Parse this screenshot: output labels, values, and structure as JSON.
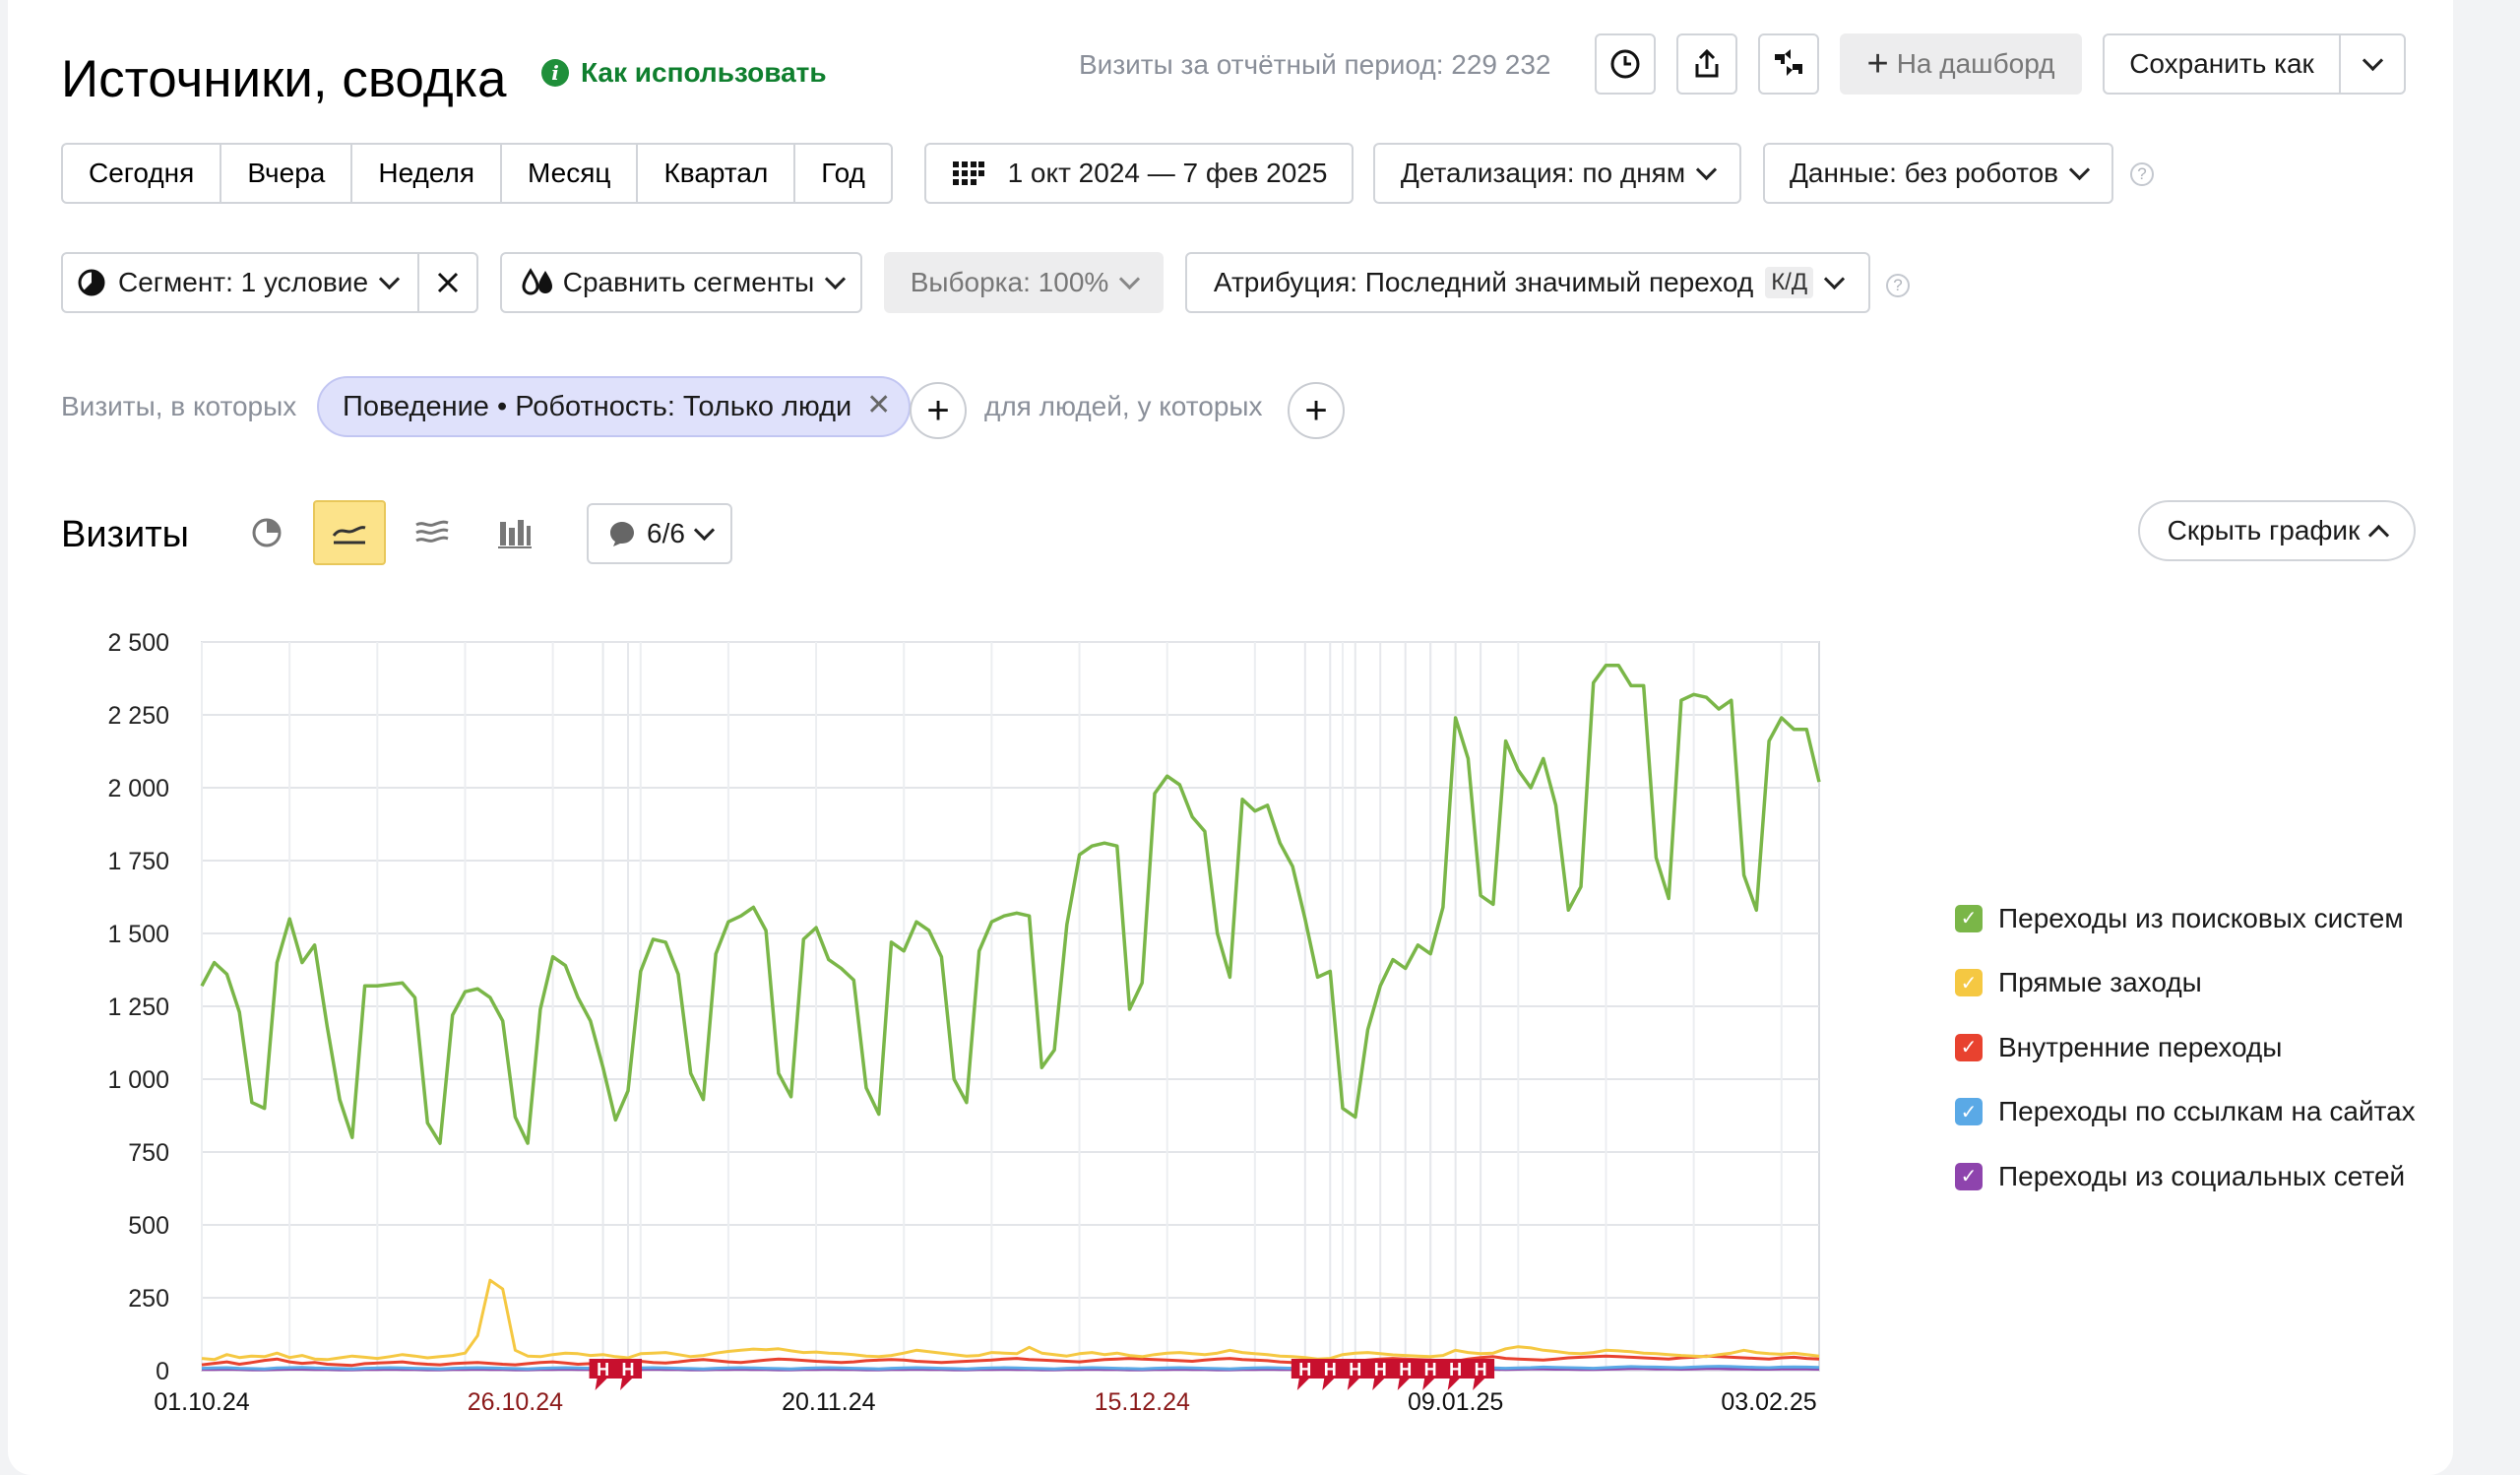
{
  "header": {
    "title": "Источники, сводка",
    "howto_label": "Как использовать",
    "visits_total": "Визиты за отчётный период: 229 232",
    "dashboard_label": "На дашборд",
    "save_as_label": "Сохранить как"
  },
  "periods": [
    "Сегодня",
    "Вчера",
    "Неделя",
    "Месяц",
    "Квартал",
    "Год"
  ],
  "date_range": "1 окт 2024 — 7 фев 2025",
  "detail_label": "Детализация: по дням",
  "data_label": "Данные: без роботов",
  "segment_label": "Сегмент: 1 условие",
  "compare_label": "Сравнить сегменты",
  "sample_label": "Выборка: 100%",
  "attribution_label": "Атрибуция: Последний значимый переход",
  "attribution_badge": "К/Д",
  "filter": {
    "prefix": "Визиты, в которых",
    "chip": "Поведение • Роботность: Только люди",
    "people_label": "для людей, у которых"
  },
  "chart_header": {
    "title": "Визиты",
    "series_counter": "6/6",
    "hide_label": "Скрыть график"
  },
  "colors": {
    "search": "#7ab648",
    "direct": "#f5c842",
    "internal": "#e8422f",
    "links": "#5aa9e6",
    "social": "#8e44ad",
    "holiday": "#c8102e"
  },
  "chart_data": {
    "type": "line",
    "y_ticks": [
      "2 500",
      "2 250",
      "2 000",
      "1 750",
      "1 500",
      "1 250",
      "1 000",
      "750",
      "500",
      "250",
      "0"
    ],
    "x_ticks": [
      "01.10.24",
      "26.10.24",
      "20.11.24",
      "15.12.24",
      "09.01.25",
      "03.02.25"
    ],
    "x_tick_index": [
      0,
      25,
      50,
      75,
      100,
      125
    ],
    "x_tick_holiday": [
      false,
      true,
      false,
      true,
      false,
      false
    ],
    "ylim": [
      0,
      2500
    ],
    "holiday_marker_label": "Н",
    "holiday_index": [
      32,
      34,
      88,
      90,
      92,
      94,
      96,
      98,
      100,
      102
    ],
    "series": [
      {
        "name": "Переходы из поисковых систем",
        "color": "#7ab648",
        "values": [
          1320,
          1400,
          1360,
          1230,
          920,
          900,
          1400,
          1550,
          1400,
          1460,
          1180,
          930,
          800,
          1320,
          1320,
          1325,
          1330,
          1280,
          850,
          780,
          1220,
          1300,
          1310,
          1280,
          1200,
          870,
          780,
          1240,
          1420,
          1390,
          1280,
          1200,
          1040,
          860,
          960,
          1370,
          1480,
          1470,
          1360,
          1020,
          930,
          1430,
          1540,
          1560,
          1590,
          1510,
          1020,
          940,
          1480,
          1520,
          1410,
          1380,
          1340,
          970,
          880,
          1470,
          1440,
          1540,
          1510,
          1420,
          1000,
          920,
          1440,
          1540,
          1560,
          1570,
          1560,
          1040,
          1100,
          1530,
          1770,
          1800,
          1810,
          1800,
          1240,
          1330,
          1980,
          2040,
          2010,
          1900,
          1850,
          1500,
          1350,
          1960,
          1920,
          1940,
          1810,
          1730,
          1550,
          1350,
          1370,
          900,
          870,
          1170,
          1320,
          1410,
          1380,
          1460,
          1430,
          1590,
          2240,
          2100,
          1630,
          1600,
          2160,
          2060,
          2000,
          2100,
          1940,
          1580,
          1660,
          2360,
          2420,
          2420,
          2350,
          2350,
          1760,
          1620,
          2300,
          2320,
          2310,
          2270,
          2300,
          1700,
          1580,
          2160,
          2240,
          2200,
          2200,
          2020
        ]
      },
      {
        "name": "Прямые заходы",
        "color": "#f5c842",
        "values": [
          42,
          38,
          55,
          45,
          50,
          48,
          60,
          45,
          52,
          40,
          38,
          44,
          50,
          46,
          42,
          48,
          55,
          50,
          44,
          48,
          52,
          60,
          120,
          310,
          280,
          70,
          50,
          48,
          55,
          60,
          58,
          52,
          55,
          48,
          44,
          58,
          60,
          62,
          55,
          48,
          52,
          60,
          66,
          70,
          74,
          72,
          75,
          68,
          62,
          64,
          60,
          58,
          55,
          50,
          48,
          52,
          60,
          70,
          65,
          60,
          55,
          50,
          52,
          62,
          60,
          58,
          80,
          60,
          55,
          50,
          58,
          62,
          55,
          60,
          52,
          48,
          55,
          60,
          62,
          58,
          55,
          60,
          70,
          62,
          58,
          55,
          50,
          48,
          45,
          40,
          42,
          55,
          60,
          62,
          58,
          54,
          52,
          50,
          48,
          52,
          70,
          62,
          58,
          60,
          75,
          82,
          78,
          70,
          66,
          60,
          58,
          62,
          70,
          68,
          65,
          60,
          58,
          55,
          52,
          50,
          48,
          55,
          60,
          70,
          62,
          58,
          56,
          60,
          55,
          50
        ]
      },
      {
        "name": "Внутренние переходы",
        "color": "#e8422f",
        "values": [
          20,
          25,
          30,
          22,
          28,
          35,
          40,
          30,
          25,
          28,
          22,
          20,
          18,
          24,
          26,
          28,
          30,
          25,
          22,
          20,
          24,
          26,
          28,
          25,
          22,
          20,
          24,
          28,
          30,
          26,
          22,
          24,
          28,
          30,
          35,
          32,
          28,
          26,
          30,
          35,
          38,
          34,
          30,
          28,
          32,
          36,
          40,
          38,
          35,
          32,
          30,
          28,
          30,
          34,
          36,
          38,
          36,
          32,
          30,
          28,
          30,
          32,
          34,
          36,
          40,
          42,
          38,
          36,
          34,
          32,
          30,
          34,
          38,
          40,
          42,
          40,
          38,
          36,
          34,
          32,
          36,
          40,
          42,
          38,
          36,
          34,
          30,
          28,
          26,
          24,
          22,
          28,
          32,
          36,
          40,
          42,
          40,
          38,
          36,
          34,
          32,
          40,
          45,
          48,
          42,
          40,
          38,
          36,
          40,
          44,
          46,
          48,
          50,
          48,
          46,
          44,
          42,
          40,
          44,
          46,
          50,
          48,
          46,
          44,
          42,
          40,
          44,
          46,
          42,
          40
        ]
      },
      {
        "name": "Переходы по ссылкам на сайтах",
        "color": "#5aa9e6",
        "values": [
          8,
          9,
          10,
          8,
          7,
          6,
          9,
          10,
          11,
          9,
          8,
          7,
          6,
          8,
          9,
          10,
          9,
          8,
          7,
          6,
          8,
          9,
          10,
          9,
          8,
          7,
          6,
          8,
          9,
          10,
          9,
          8,
          7,
          6,
          8,
          9,
          10,
          9,
          8,
          7,
          6,
          8,
          9,
          10,
          9,
          8,
          7,
          6,
          8,
          9,
          10,
          9,
          8,
          7,
          6,
          8,
          9,
          10,
          9,
          8,
          7,
          6,
          8,
          9,
          10,
          9,
          8,
          7,
          6,
          8,
          9,
          10,
          9,
          8,
          7,
          6,
          8,
          9,
          10,
          9,
          8,
          7,
          6,
          8,
          9,
          10,
          9,
          8,
          7,
          6,
          8,
          9,
          10,
          9,
          8,
          7,
          6,
          8,
          9,
          10,
          12,
          11,
          10,
          9,
          8,
          9,
          10,
          12,
          11,
          10,
          9,
          8,
          10,
          12,
          14,
          13,
          12,
          11,
          10,
          12,
          14,
          15,
          14,
          12,
          11,
          10,
          12,
          13,
          12,
          11
        ]
      },
      {
        "name": "Переходы из социальных сетей",
        "color": "#8e44ad",
        "values": [
          4,
          4,
          5,
          4,
          3,
          3,
          4,
          5,
          5,
          4,
          4,
          3,
          3,
          4,
          4,
          5,
          4,
          4,
          3,
          3,
          4,
          4,
          5,
          4,
          4,
          3,
          3,
          4,
          4,
          5,
          4,
          4,
          3,
          3,
          4,
          4,
          5,
          4,
          4,
          3,
          3,
          4,
          4,
          5,
          4,
          4,
          3,
          3,
          4,
          4,
          5,
          4,
          4,
          3,
          3,
          4,
          4,
          5,
          4,
          4,
          3,
          3,
          4,
          4,
          5,
          4,
          4,
          3,
          3,
          4,
          4,
          5,
          4,
          4,
          3,
          3,
          4,
          4,
          5,
          4,
          4,
          3,
          3,
          4,
          4,
          5,
          4,
          4,
          3,
          3,
          4,
          4,
          5,
          4,
          4,
          3,
          3,
          4,
          4,
          5,
          6,
          6,
          5,
          5,
          4,
          5,
          6,
          6,
          5,
          5,
          4,
          4,
          5,
          6,
          7,
          7,
          6,
          6,
          5,
          6,
          7,
          7,
          6,
          6,
          5,
          5,
          6,
          6,
          6,
          5
        ]
      }
    ]
  }
}
